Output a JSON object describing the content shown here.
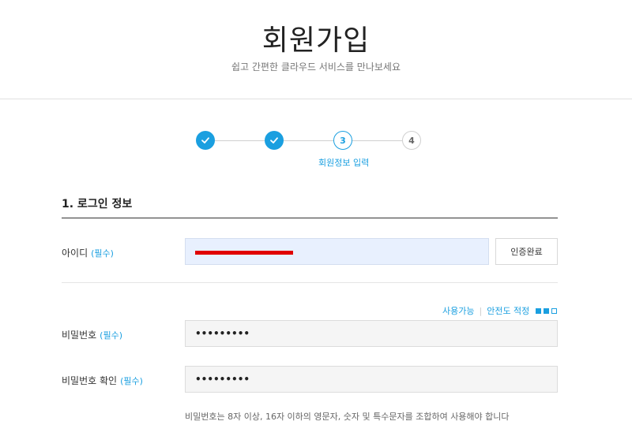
{
  "header": {
    "title": "회원가입",
    "subtitle": "쉽고 간편한 클라우드 서비스를 만나보세요"
  },
  "stepper": {
    "steps": [
      {
        "label": "✓",
        "state": "done"
      },
      {
        "label": "✓",
        "state": "done"
      },
      {
        "label": "3",
        "state": "active",
        "caption": "회원정보 입력"
      },
      {
        "label": "4",
        "state": "todo"
      }
    ]
  },
  "section": {
    "title": "1. 로그인 정보"
  },
  "fields": {
    "id": {
      "label": "아이디",
      "required": "(필수)",
      "verify_button": "인증완료"
    },
    "password": {
      "label": "비밀번호",
      "required": "(필수)",
      "value": "•••••••••"
    },
    "password_confirm": {
      "label": "비밀번호 확인",
      "required": "(필수)",
      "value": "•••••••••"
    }
  },
  "password_status": {
    "available": "사용가능",
    "safety": "안전도 적정",
    "strength_level": 2,
    "strength_max": 3
  },
  "hint": "비밀번호는 8자 이상, 16자 이하의 영문자, 숫자 및 특수문자를 조합하여 사용해야 합니다",
  "colors": {
    "accent": "#1a9fe0",
    "redaction": "#e00000"
  }
}
